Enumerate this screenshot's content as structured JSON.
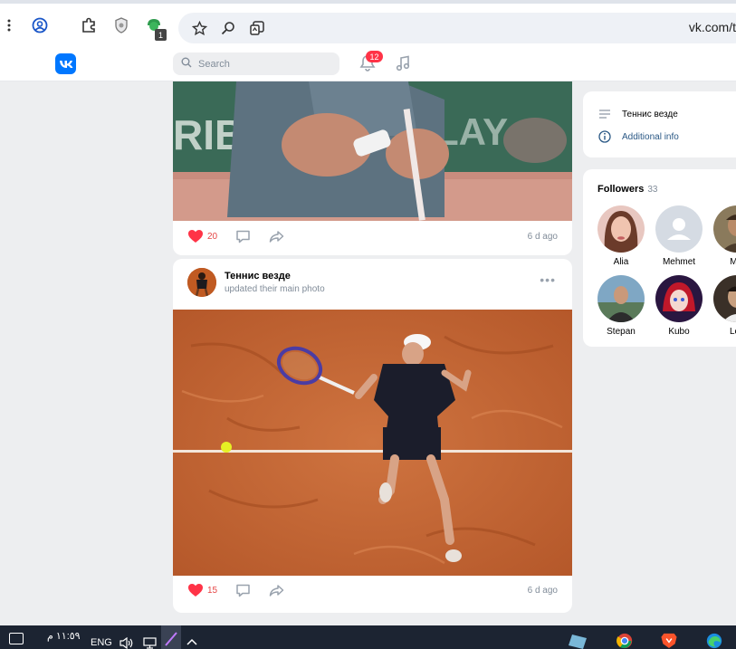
{
  "browser": {
    "url": "vk.com/t",
    "extension_badge": "1"
  },
  "header": {
    "search_placeholder": "Search",
    "notification_count": "12"
  },
  "posts": [
    {
      "likes": "20",
      "time": "6 d ago"
    },
    {
      "author": "Теннис везде",
      "subtitle": "updated their main photo",
      "likes": "15",
      "time": "6 d ago"
    }
  ],
  "sidebar": {
    "group_name": "Теннис везде",
    "additional_info": "Additional info",
    "followers_title": "Followers",
    "followers_count": "33",
    "followers": [
      {
        "name": "Alia"
      },
      {
        "name": "Mehmet"
      },
      {
        "name": "Mik"
      },
      {
        "name": "Stepan"
      },
      {
        "name": "Kubo"
      },
      {
        "name": "Lev"
      }
    ]
  },
  "taskbar": {
    "time": "١١:٥٩ م",
    "language": "ENG"
  },
  "colors": {
    "vk_blue": "#0077ff",
    "like_red": "#e64646",
    "badge_red": "#ff3347",
    "link_blue": "#2a5885"
  }
}
